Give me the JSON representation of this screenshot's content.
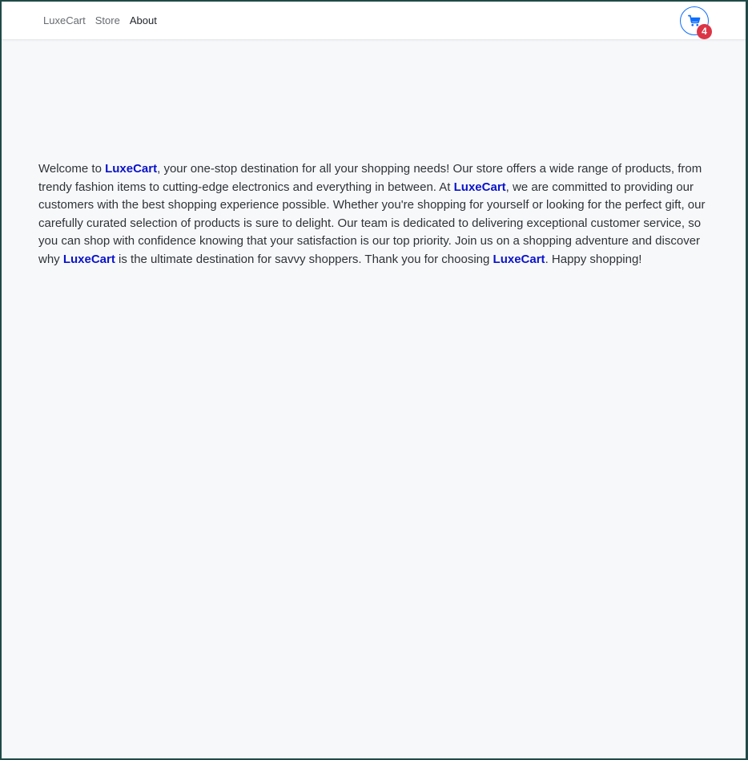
{
  "nav": {
    "links": [
      {
        "label": "LuxeCart",
        "active": false
      },
      {
        "label": "Store",
        "active": false
      },
      {
        "label": "About",
        "active": true
      }
    ],
    "cart": {
      "icon": "cart-icon",
      "count": "4"
    }
  },
  "about": {
    "brand": "LuxeCart",
    "segments": [
      "Welcome to ",
      ", your one-stop destination for all your shopping needs! Our store offers a wide range of products, from trendy fashion items to cutting-edge electronics and everything in between. At ",
      ", we are committed to providing our customers with the best shopping experience possible. Whether you're shopping for yourself or looking for the perfect gift, our carefully curated selection of products is sure to delight. Our team is dedicated to delivering exceptional customer service, so you can shop with confidence knowing that your satisfaction is our top priority. Join us on a shopping adventure and discover why ",
      " is the ultimate destination for savvy shoppers. Thank you for choosing ",
      ". Happy shopping!"
    ]
  },
  "colors": {
    "brand_text": "#0a13c8",
    "primary": "#0d6efd",
    "badge": "#dc3545",
    "page_bg": "#f7f8fa",
    "frame": "#1f4a47"
  }
}
